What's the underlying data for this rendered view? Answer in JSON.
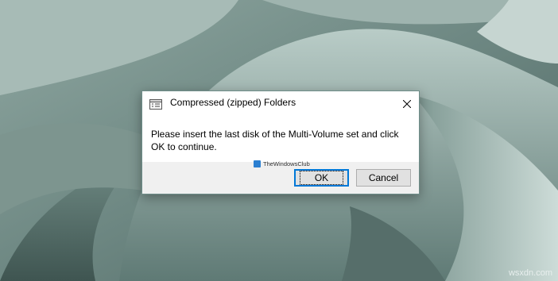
{
  "dialog": {
    "title": "Compressed (zipped) Folders",
    "app_icon": "zip-folder-icon",
    "close_icon": "close-icon",
    "message": "Please insert the last disk of the Multi-Volume set and click OK to continue.",
    "ok_label": "OK",
    "cancel_label": "Cancel",
    "watermark_text": "TheWindowsClub"
  },
  "site_watermark": "wsxdn.com",
  "colors": {
    "wallpaper": "#5f7a75",
    "dialog_bg": "#ffffff",
    "footer_bg": "#f0f0f0",
    "focus_border": "#0078d7"
  }
}
